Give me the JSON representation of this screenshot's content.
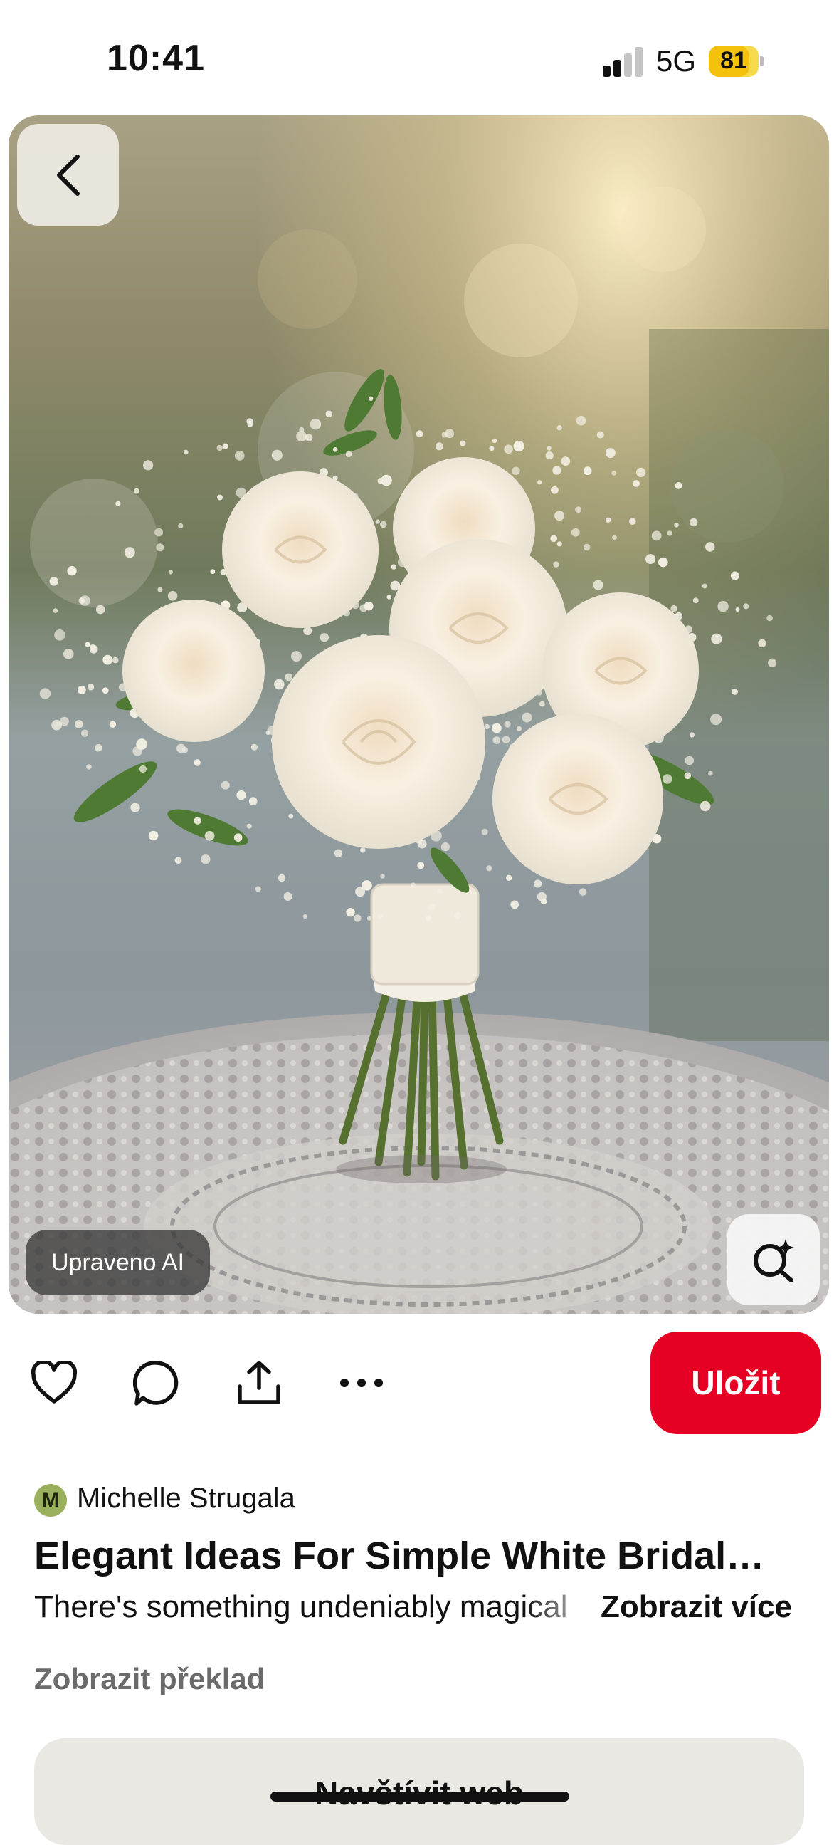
{
  "status_bar": {
    "time": "10:41",
    "network": "5G",
    "battery_level": "81",
    "battery_fraction": 0.81,
    "battery_color": "#f4c20d"
  },
  "pin": {
    "image_alt": "White rose and baby's breath bridal bouquet on a lace table",
    "ai_badge": "Upraveno AI",
    "save_label": "Uložit",
    "save_color": "#e60023",
    "author": {
      "initial": "M",
      "name": "Michelle Strugala"
    },
    "title": "Elegant Ideas For Simple White Bridal…",
    "description_preview": "There's something undeniably magical about",
    "show_more_label": "Zobrazit více",
    "translate_label": "Zobrazit překlad",
    "visit_label": "Navštívit web"
  },
  "icons": {
    "back": "chevron-left-icon",
    "lens": "visual-search-icon",
    "like": "heart-icon",
    "comment": "comment-icon",
    "share": "share-icon",
    "more": "more-icon"
  }
}
